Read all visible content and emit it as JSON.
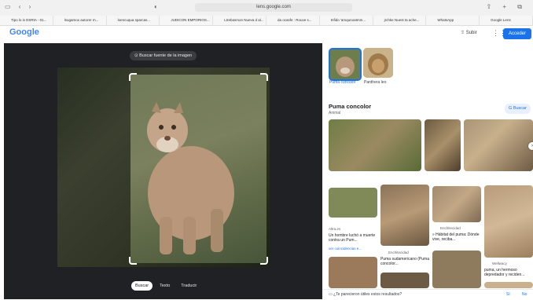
{
  "browser": {
    "url": "lens.google.com",
    "bookmarks": [
      "Tipo lo is DSRtA - 01...",
      "lsugamox autorer m...",
      "loencuqua sparcas...",
      "JUDICON EMPORIOS...",
      "Ltrebasmon Nueva d al...",
      "da ocasfe : Rouve s...",
      "tnfido 'amqunoatmm...",
      "jrchke Nuest ta ache...",
      "WhatsApp",
      "Google Lens"
    ]
  },
  "header": {
    "logo": "Google",
    "share_label": "Subir",
    "signin_label": "Acceder"
  },
  "viewer": {
    "search_chip": "Buscar fuente de la imagen",
    "modes": [
      "Buscar",
      "Texto",
      "Traducir"
    ]
  },
  "results": {
    "candidates": [
      {
        "label": "Puma concolor"
      },
      {
        "label": "Panthera leo"
      }
    ],
    "entity": {
      "title": "Puma concolor",
      "subtitle": "Animal",
      "search_button": "Buscar"
    },
    "cards": [
      {
        "source": "Altra.es",
        "title": "Un hombre luchó a muerte contra un Pum...",
        "extra": "ver coincidencias e..."
      },
      {
        "source": "Enchitecidad",
        "title": "Puma sudamericano (Puma concolor..."
      },
      {
        "source": "Enchitecidad",
        "title": "» Hábitat del puma: Dónde vive, reciba..."
      },
      {
        "source": "Wellwacy",
        "title": "puma, un hermoso depredador y reciden..."
      }
    ],
    "feedback": {
      "question": "¿Te parecieron útiles estos resultados?",
      "yes": "Sí",
      "no": "No"
    }
  },
  "colors": {
    "accent": "#1a73e8",
    "viewer_bg": "#1f2125"
  }
}
